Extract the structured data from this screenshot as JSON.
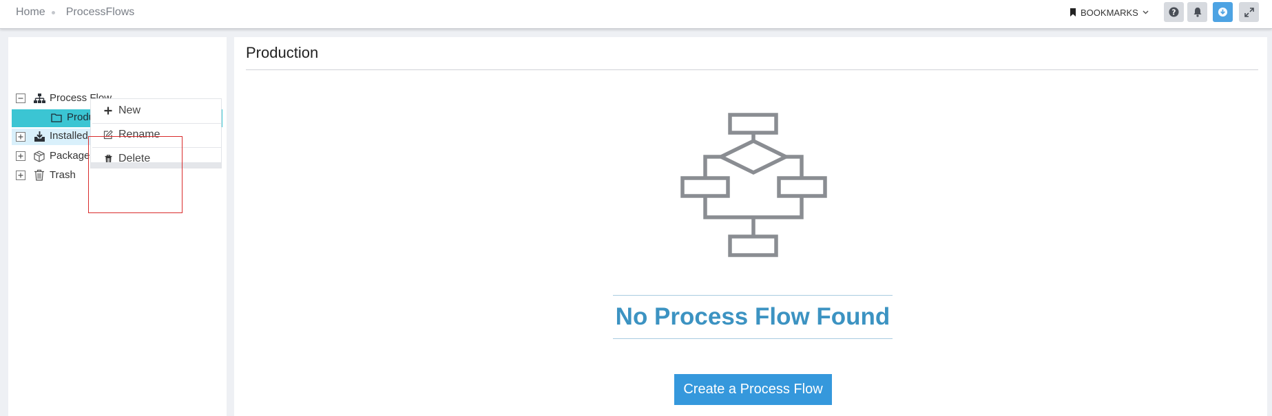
{
  "breadcrumb": {
    "home": "Home",
    "current": "ProcessFlows"
  },
  "toolbar": {
    "bookmarks_label": "BOOKMARKS",
    "icons": [
      "bookmark-icon",
      "chevron-down-icon",
      "help-icon",
      "bell-icon",
      "download-icon",
      "expand-icon"
    ]
  },
  "tree": {
    "items": [
      {
        "label": "Process Flow",
        "icon": "sitemap-icon",
        "expanded": true
      },
      {
        "label": "Production",
        "icon": "folder-icon",
        "selected": true
      },
      {
        "label": "Installed Process Fl",
        "icon": "inbox-download-icon"
      },
      {
        "label": "Packages",
        "icon": "cubes-icon"
      },
      {
        "label": "Trash",
        "icon": "trash-icon"
      }
    ]
  },
  "context_menu": {
    "items": [
      {
        "label": "New",
        "icon": "plus-icon"
      },
      {
        "label": "Rename",
        "icon": "edit-icon"
      },
      {
        "label": "Delete",
        "icon": "trash-icon"
      }
    ]
  },
  "main": {
    "title": "Production",
    "empty_state": {
      "icon": "flowchart-icon",
      "message": "No Process Flow Found",
      "button_label": "Create a Process Flow"
    }
  },
  "colors": {
    "selected_row": "#3bc5d3",
    "accent_blue": "#3598dc",
    "empty_title": "#3c93c2",
    "context_border": "#d92b2b"
  }
}
